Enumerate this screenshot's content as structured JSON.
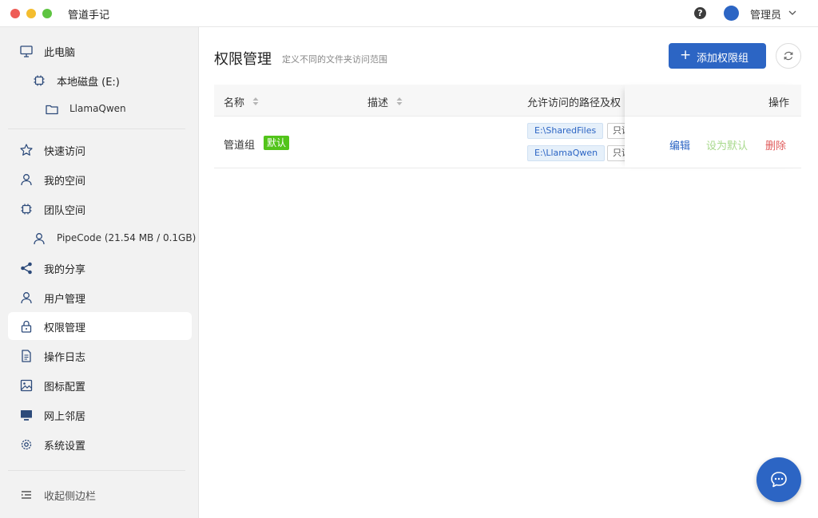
{
  "app": {
    "title": "管道手记"
  },
  "header": {
    "help_glyph": "?",
    "user_name": "管理员"
  },
  "sidebar": {
    "computer": "此电脑",
    "disk": "本地磁盘 (E:)",
    "folder": "LlamaQwen",
    "items": [
      {
        "label": "快速访问",
        "icon": "star-icon"
      },
      {
        "label": "我的空间",
        "icon": "user-icon"
      },
      {
        "label": "团队空间",
        "icon": "chip-icon"
      },
      {
        "label": "PipeCode (21.54 MB / 0.1GB)",
        "icon": "user-icon"
      },
      {
        "label": "我的分享",
        "icon": "share-icon"
      },
      {
        "label": "用户管理",
        "icon": "user-icon"
      },
      {
        "label": "权限管理",
        "icon": "lock-icon",
        "active": true
      },
      {
        "label": "操作日志",
        "icon": "document-icon"
      },
      {
        "label": "图标配置",
        "icon": "image-icon"
      },
      {
        "label": "网上邻居",
        "icon": "monitor-icon"
      },
      {
        "label": "系统设置",
        "icon": "gear-icon"
      }
    ],
    "collapse": "收起侧边栏"
  },
  "main": {
    "title": "权限管理",
    "subtitle": "定义不同的文件夹访问范围",
    "add_button": "添加权限组",
    "add_icon": "+",
    "table": {
      "columns": [
        "名称",
        "描述",
        "允许访问的路径及权",
        "操作"
      ],
      "rows": [
        {
          "name": "管道组",
          "badge": "默认",
          "description": "",
          "paths": [
            {
              "path": "E:\\SharedFiles",
              "perm": "只读"
            },
            {
              "path": "E:\\LlamaQwen",
              "perm": "只读"
            }
          ],
          "actions": {
            "edit": "编辑",
            "set_default": "设为默认",
            "delete": "删除"
          }
        }
      ]
    }
  },
  "colors": {
    "accent": "#2c65c4",
    "badge_green": "#52c41a",
    "delete_red": "#e05c5c",
    "disabled_green": "#a8d98c",
    "sidebar_bg": "#f2f2f2"
  }
}
